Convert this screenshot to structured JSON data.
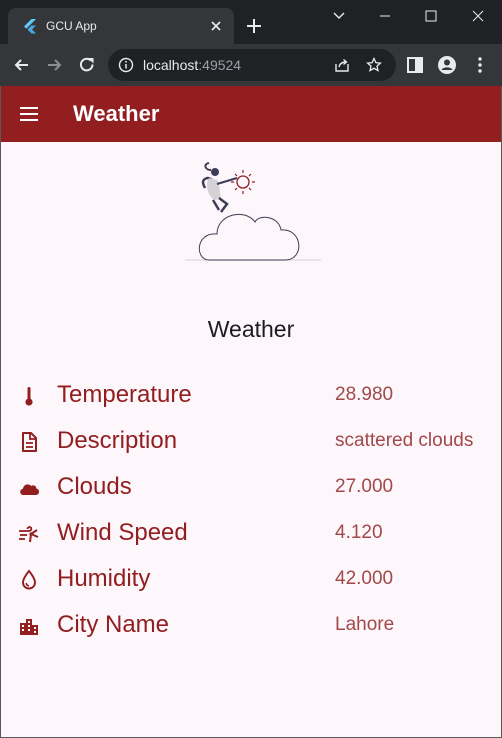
{
  "browser": {
    "tab_title": "GCU App",
    "url_host": "localhost",
    "url_port": ":49524"
  },
  "app": {
    "title": "Weather",
    "heading": "Weather",
    "accent_color": "#921e20",
    "rows": [
      {
        "icon": "thermometer-icon",
        "label": "Temperature",
        "value": "28.980"
      },
      {
        "icon": "description-icon",
        "label": "Description",
        "value": "scattered clouds"
      },
      {
        "icon": "cloud-icon",
        "label": "Clouds",
        "value": "27.000"
      },
      {
        "icon": "wind-icon",
        "label": "Wind Speed",
        "value": "4.120"
      },
      {
        "icon": "water-drop-icon",
        "label": "Humidity",
        "value": "42.000"
      },
      {
        "icon": "city-icon",
        "label": "City Name",
        "value": "Lahore"
      }
    ]
  }
}
